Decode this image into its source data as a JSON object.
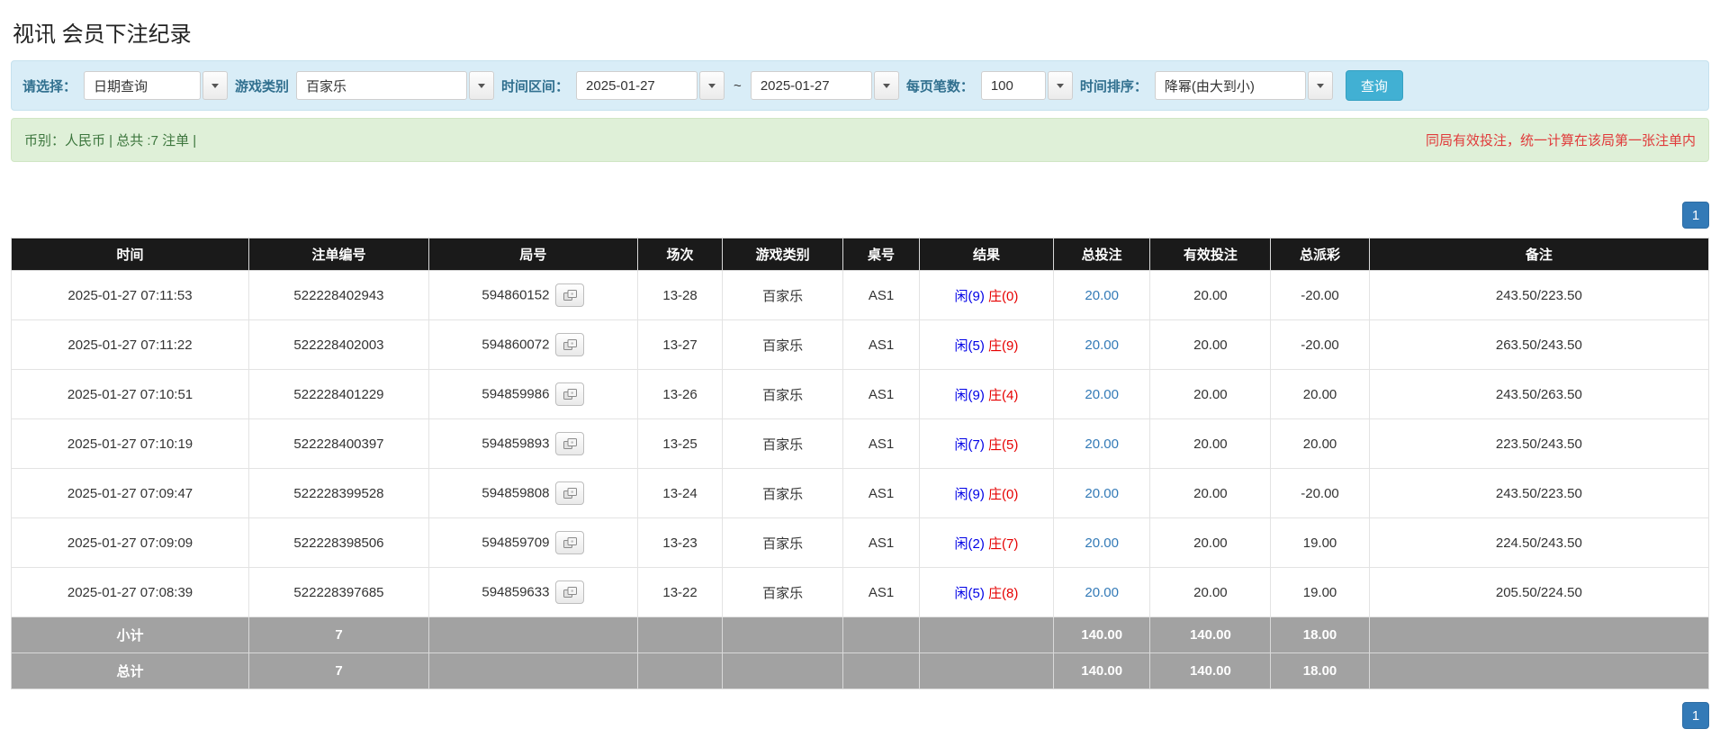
{
  "page": {
    "title": "视讯 会员下注纪录"
  },
  "filter": {
    "mode_label": "请选择：",
    "mode_value": "日期查询",
    "game_label": "游戏类别",
    "game_value": "百家乐",
    "range_label": "时间区间：",
    "date_from": "2025-01-27",
    "range_separator": "~",
    "date_to": "2025-01-27",
    "per_page_label": "每页笔数：",
    "per_page_value": "100",
    "sort_label": "时间排序：",
    "sort_value": "降幂(由大到小)",
    "search_button_label": "查询"
  },
  "summary": {
    "left_text": "币别：人民币 | 总共 :7 注单 |",
    "right_notice": "同局有效投注，统一计算在该局第一张注单内"
  },
  "pagination": {
    "top_page": "1",
    "bottom_page": "1"
  },
  "table": {
    "headers": [
      "时间",
      "注单编号",
      "局号",
      "场次",
      "游戏类别",
      "桌号",
      "结果",
      "总投注",
      "有效投注",
      "总派彩",
      "备注"
    ],
    "rows": [
      {
        "time": "2025-01-27 07:11:53",
        "bet_id": "522228402943",
        "round": "594860152",
        "session": "13-28",
        "game": "百家乐",
        "table_no": "AS1",
        "result_player": "闲(9)",
        "result_banker": "庄(0)",
        "total_bet": "20.00",
        "valid_bet": "20.00",
        "payout": "-20.00",
        "remark": "243.50/223.50"
      },
      {
        "time": "2025-01-27 07:11:22",
        "bet_id": "522228402003",
        "round": "594860072",
        "session": "13-27",
        "game": "百家乐",
        "table_no": "AS1",
        "result_player": "闲(5)",
        "result_banker": "庄(9)",
        "total_bet": "20.00",
        "valid_bet": "20.00",
        "payout": "-20.00",
        "remark": "263.50/243.50"
      },
      {
        "time": "2025-01-27 07:10:51",
        "bet_id": "522228401229",
        "round": "594859986",
        "session": "13-26",
        "game": "百家乐",
        "table_no": "AS1",
        "result_player": "闲(9)",
        "result_banker": "庄(4)",
        "total_bet": "20.00",
        "valid_bet": "20.00",
        "payout": "20.00",
        "remark": "243.50/263.50"
      },
      {
        "time": "2025-01-27 07:10:19",
        "bet_id": "522228400397",
        "round": "594859893",
        "session": "13-25",
        "game": "百家乐",
        "table_no": "AS1",
        "result_player": "闲(7)",
        "result_banker": "庄(5)",
        "total_bet": "20.00",
        "valid_bet": "20.00",
        "payout": "20.00",
        "remark": "223.50/243.50"
      },
      {
        "time": "2025-01-27 07:09:47",
        "bet_id": "522228399528",
        "round": "594859808",
        "session": "13-24",
        "game": "百家乐",
        "table_no": "AS1",
        "result_player": "闲(9)",
        "result_banker": "庄(0)",
        "total_bet": "20.00",
        "valid_bet": "20.00",
        "payout": "-20.00",
        "remark": "243.50/223.50"
      },
      {
        "time": "2025-01-27 07:09:09",
        "bet_id": "522228398506",
        "round": "594859709",
        "session": "13-23",
        "game": "百家乐",
        "table_no": "AS1",
        "result_player": "闲(2)",
        "result_banker": "庄(7)",
        "total_bet": "20.00",
        "valid_bet": "20.00",
        "payout": "19.00",
        "remark": "224.50/243.50"
      },
      {
        "time": "2025-01-27 07:08:39",
        "bet_id": "522228397685",
        "round": "594859633",
        "session": "13-22",
        "game": "百家乐",
        "table_no": "AS1",
        "result_player": "闲(5)",
        "result_banker": "庄(8)",
        "total_bet": "20.00",
        "valid_bet": "20.00",
        "payout": "19.00",
        "remark": "205.50/224.50"
      }
    ],
    "footer_rows": [
      {
        "label": "小计",
        "count": "7",
        "total_bet": "140.00",
        "valid_bet": "140.00",
        "payout": "18.00"
      },
      {
        "label": "总计",
        "count": "7",
        "total_bet": "140.00",
        "valid_bet": "140.00",
        "payout": "18.00"
      }
    ]
  },
  "icons": {
    "combo_caret": "chevron-down-icon",
    "round_detail": "round-replay-cards-icon"
  },
  "colors": {
    "filter_bar_bg": "#d9edf7",
    "filter_label_text": "#31708f",
    "summary_bar_bg": "#dff0d8",
    "summary_text_green": "#3c763d",
    "notice_red": "#e03a3a",
    "table_header_bg": "#1a1a1a",
    "footer_row_bg": "#a2a2a2",
    "link_blue": "#337ab7",
    "player_blue": "#0000e6",
    "banker_red": "#e60000",
    "negative_red": "#e60000",
    "search_button_bg": "#41b0d3",
    "pager_bg": "#337ab7"
  }
}
